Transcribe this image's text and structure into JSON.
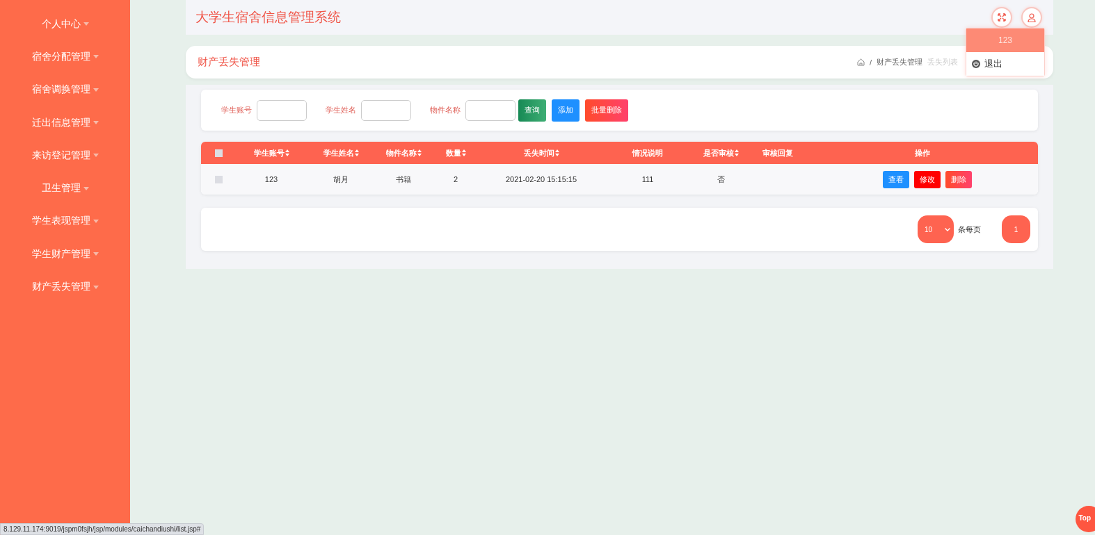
{
  "sidebar": {
    "items": [
      {
        "label": "个人中心"
      },
      {
        "label": "宿舍分配管理"
      },
      {
        "label": "宿舍调换管理"
      },
      {
        "label": "迁出信息管理"
      },
      {
        "label": "来访登记管理"
      },
      {
        "label": "卫生管理"
      },
      {
        "label": "学生表现管理"
      },
      {
        "label": "学生财产管理"
      },
      {
        "label": "财产丢失管理"
      }
    ]
  },
  "header": {
    "title": "大学生宿舍信息管理系统"
  },
  "user_menu": {
    "username": "123",
    "logout": "退出"
  },
  "page_title": "财产丢失管理",
  "breadcrumb": [
    {
      "kind": "separator",
      "text": "/"
    },
    {
      "kind": "link",
      "text": "财产丢失管理"
    },
    {
      "kind": "current",
      "text": "丢失列表"
    }
  ],
  "search": {
    "fields": [
      {
        "label": "学生账号"
      },
      {
        "label": "学生姓名"
      },
      {
        "label": "物件名称"
      }
    ],
    "buttons": [
      {
        "label": "查询",
        "kind": "search"
      },
      {
        "label": "添加",
        "kind": "add"
      },
      {
        "label": "批量删除",
        "kind": "delete"
      }
    ]
  },
  "table": {
    "header_checkbox": {
      "checked": false
    },
    "columns": [
      {
        "label": "学生账号",
        "sortable": true
      },
      {
        "label": "学生姓名",
        "sortable": true
      },
      {
        "label": "物件名称",
        "sortable": true
      },
      {
        "label": "数量",
        "sortable": true
      },
      {
        "label": "丢失时间",
        "sortable": true
      },
      {
        "label": "情况说明",
        "sortable": false
      },
      {
        "label": "是否审核",
        "sortable": true
      },
      {
        "label": "审核回复",
        "sortable": false
      },
      {
        "label": "操作",
        "sortable": false
      }
    ],
    "rows": [
      {
        "checked": false,
        "cells": [
          "123",
          "胡月",
          "书籍",
          "2",
          "2021-02-20 15:15:15",
          "111",
          "否",
          null
        ],
        "actions": [
          {
            "label": "查看",
            "kind": "view"
          },
          {
            "label": "修改",
            "kind": "edit"
          },
          {
            "label": "删除",
            "kind": "delete"
          }
        ]
      }
    ]
  },
  "pagination": {
    "page_size": "10",
    "page_size_label": "条每页",
    "pages": [
      {
        "label": "1",
        "selected": true
      }
    ]
  },
  "status_bar": {
    "url": "8.129.11.174:9019/jspm0fsjh/jsp/modules/caichandiushi/list.jsp#"
  },
  "back_to_top": {
    "label": "Top"
  }
}
